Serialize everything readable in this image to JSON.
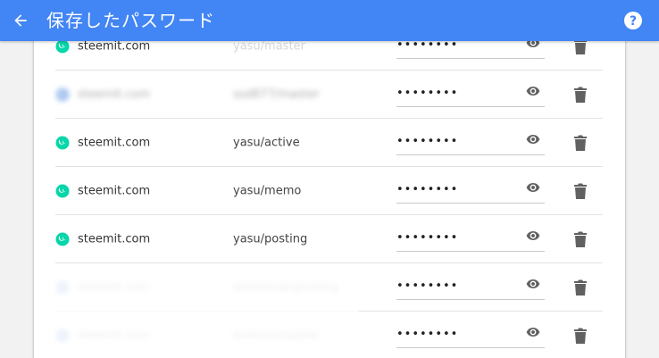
{
  "header": {
    "title": "保存したパスワード",
    "back_icon": "arrow-left-icon",
    "help_icon": "help-icon"
  },
  "colors": {
    "header_bg": "#4285f4",
    "steemit_icon": "#06d6a9",
    "blurred_icon": "#7aa7e8"
  },
  "passwords": [
    {
      "site": "steemit.com",
      "user": "yasu/master",
      "password": "••••••••",
      "blurred": false
    },
    {
      "site": "steemit.com",
      "user": "ssd877/master",
      "password": "••••••••",
      "blurred": true
    },
    {
      "site": "steemit.com",
      "user": "yasu/active",
      "password": "••••••••",
      "blurred": false
    },
    {
      "site": "steemit.com",
      "user": "yasu/memo",
      "password": "••••••••",
      "blurred": false
    },
    {
      "site": "steemit.com",
      "user": "yasu/posting",
      "password": "••••••••",
      "blurred": false
    },
    {
      "site": "steemit.com",
      "user": "steemmanposting",
      "password": "••••••••",
      "blurred": true
    },
    {
      "site": "steemit.com",
      "user": "bostoncmaster",
      "password": "••••••••",
      "blurred": true
    }
  ]
}
